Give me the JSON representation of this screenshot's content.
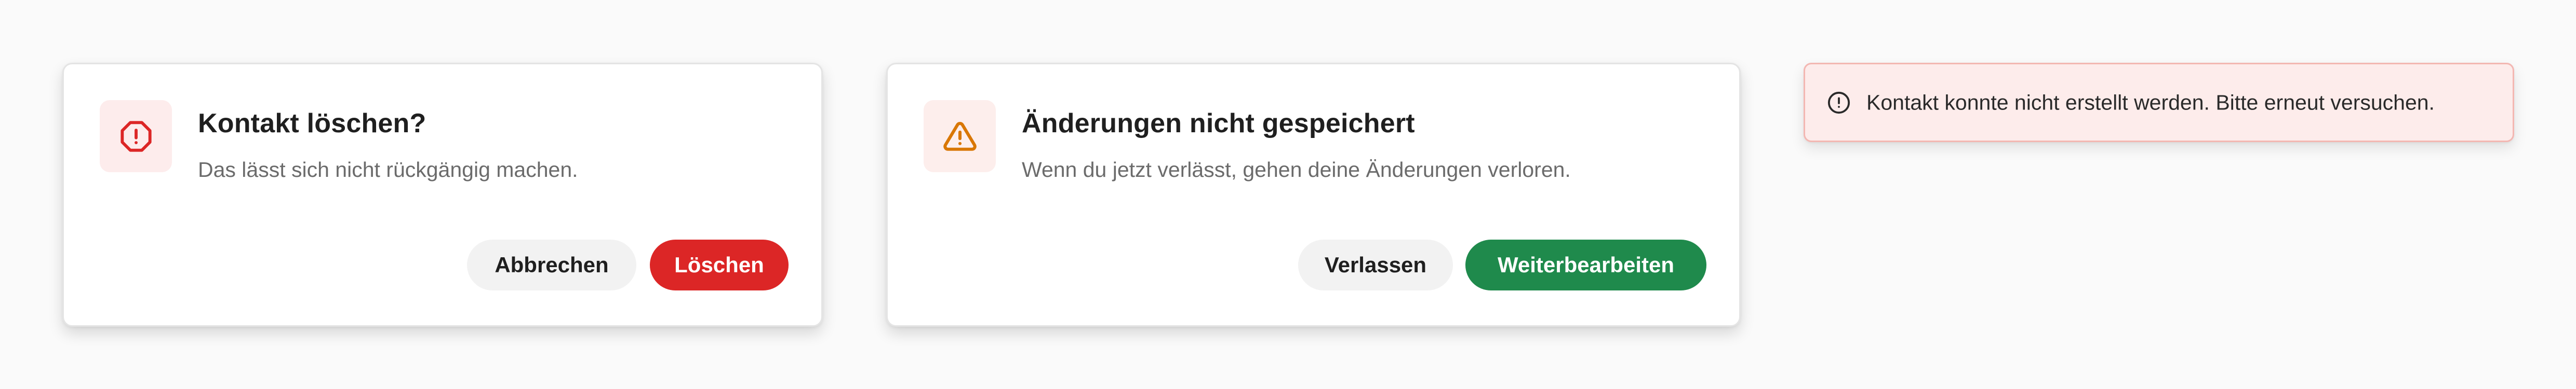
{
  "delete_dialog": {
    "title": "Kontakt löschen?",
    "text": "Das lässt sich nicht rückgängig machen.",
    "icon": "octagon-alert-icon",
    "cancel_label": "Abbrechen",
    "confirm_label": "Löschen"
  },
  "unsaved_dialog": {
    "title": "Änderungen nicht gespeichert",
    "text": "Wenn du jetzt verlässt, gehen deine Änderungen verloren.",
    "icon": "warning-triangle-icon",
    "leave_label": "Verlassen",
    "continue_label": "Weiterbearbeiten"
  },
  "error_toast": {
    "message": "Kontakt konnte nicht erstellt werden. Bitte erneut versuchen.",
    "icon": "alert-circle-icon"
  },
  "colors": {
    "danger": "#dc2626",
    "success": "#1f8a4c",
    "warning": "#d97706",
    "toast_background": "#fdeceb"
  }
}
